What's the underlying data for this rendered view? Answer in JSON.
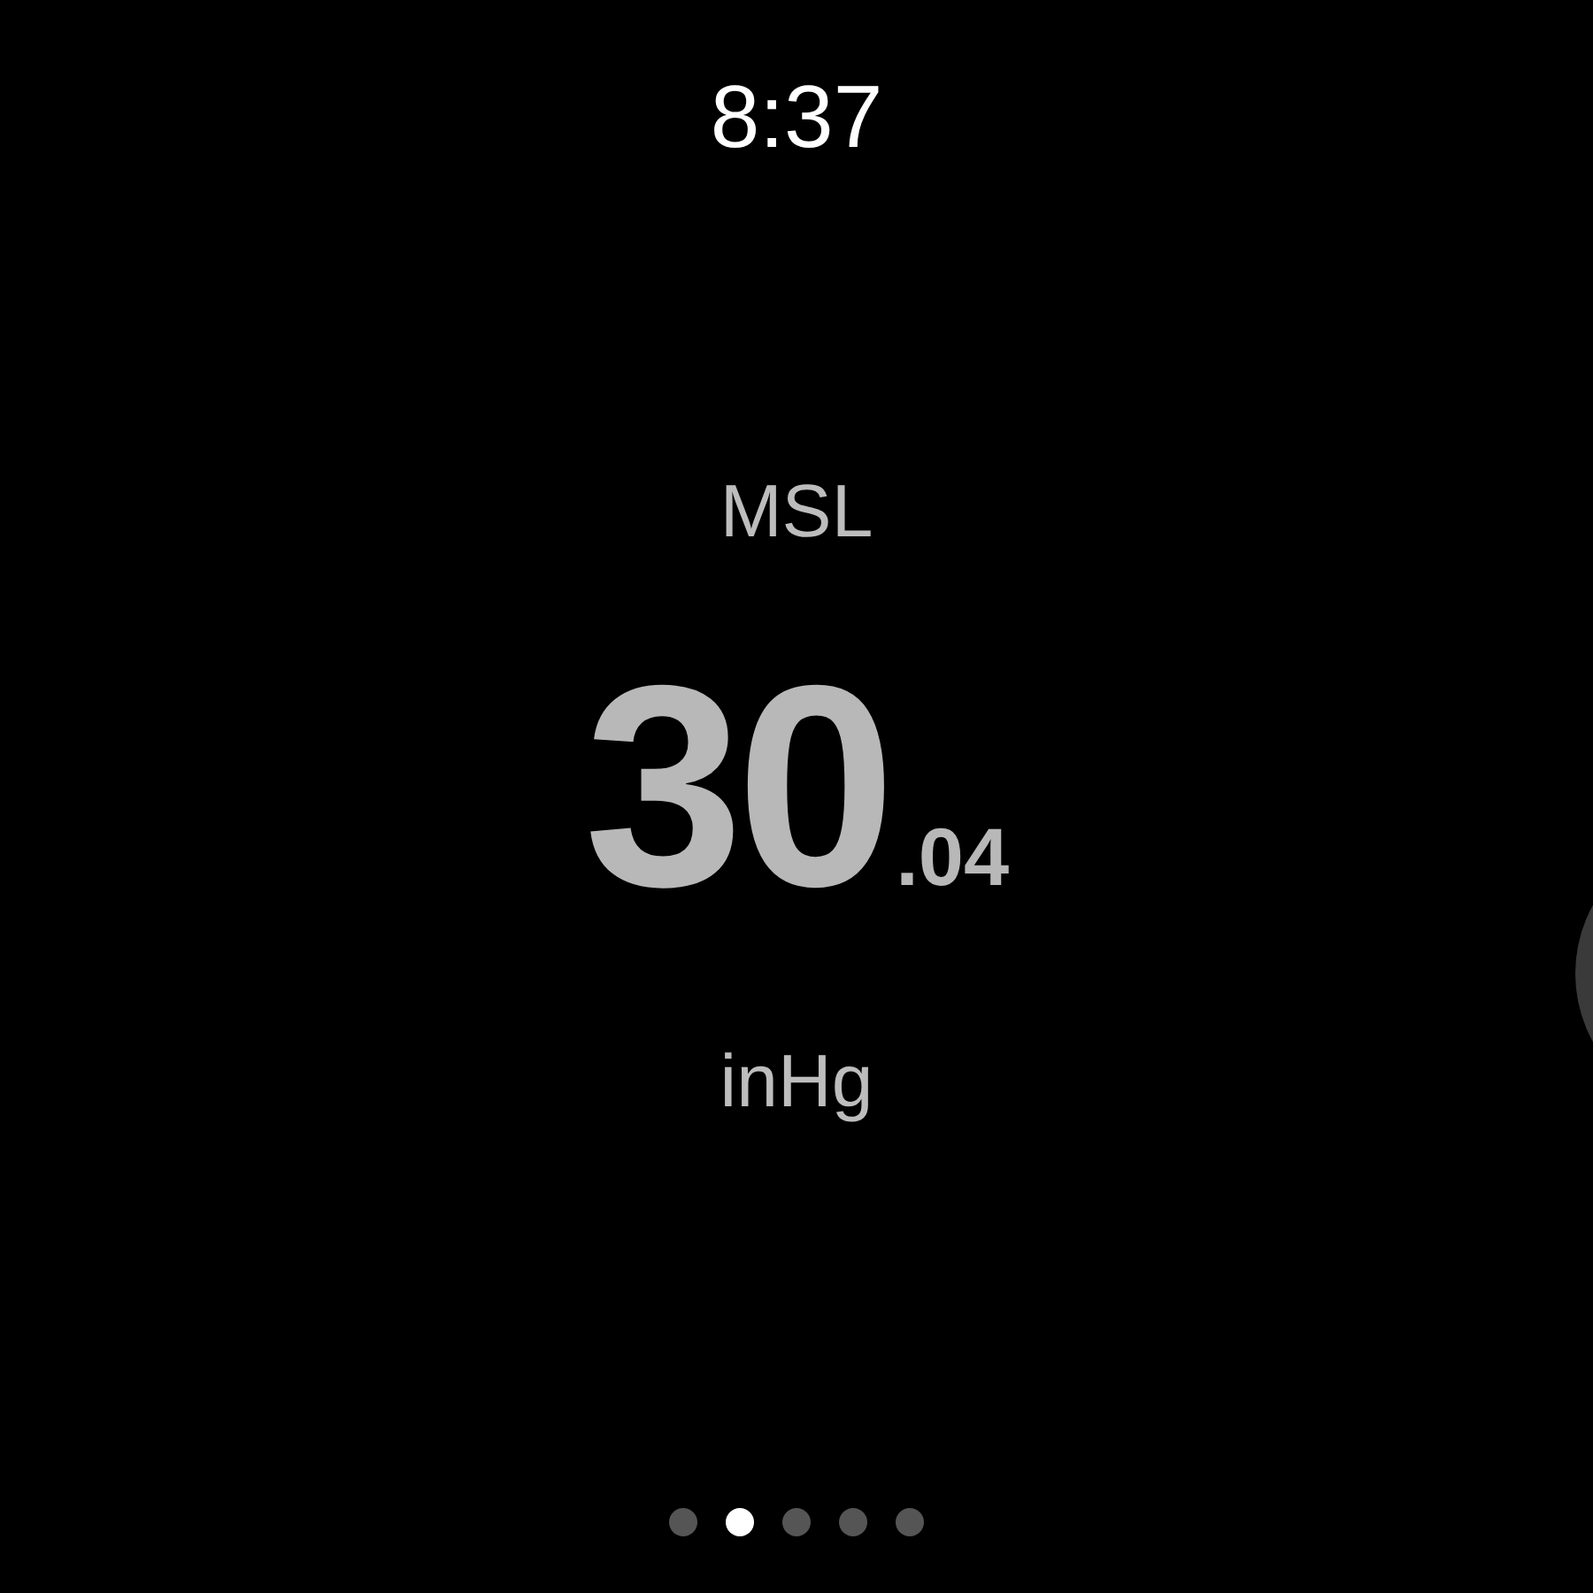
{
  "time": "8:37",
  "reading": {
    "label": "MSL",
    "whole": "30",
    "fraction": ".04",
    "unit": "inHg"
  },
  "pages": [
    {
      "selected": false
    },
    {
      "selected": true
    },
    {
      "selected": false
    },
    {
      "selected": false
    },
    {
      "selected": false
    }
  ]
}
